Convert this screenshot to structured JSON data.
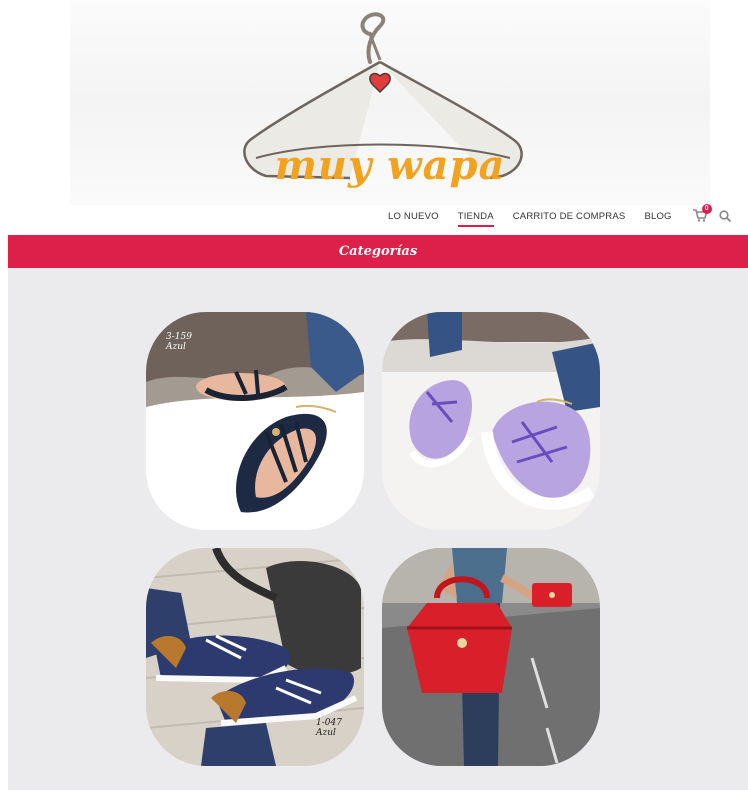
{
  "brand": {
    "logo_text": "muy wapa",
    "accent_color": "#dd2049",
    "logo_color": "#f2a21e"
  },
  "nav": {
    "items": [
      {
        "label": "LO NUEVO",
        "active": false
      },
      {
        "label": "TIENDA",
        "active": true
      },
      {
        "label": "CARRITO DE COMPRAS",
        "active": false
      },
      {
        "label": "BLOG",
        "active": false
      }
    ],
    "cart_count": "0",
    "cart_icon": "shopping-cart-icon",
    "search_icon": "search-icon"
  },
  "categories": {
    "title": "Categorías",
    "tiles": [
      {
        "name": "sandals",
        "caption_line1": "3-159",
        "caption_line2": "Azul"
      },
      {
        "name": "lilac-sneakers"
      },
      {
        "name": "navy-sneakers",
        "caption_line1": "1-047",
        "caption_line2": "Azul"
      },
      {
        "name": "red-handbag"
      }
    ]
  }
}
